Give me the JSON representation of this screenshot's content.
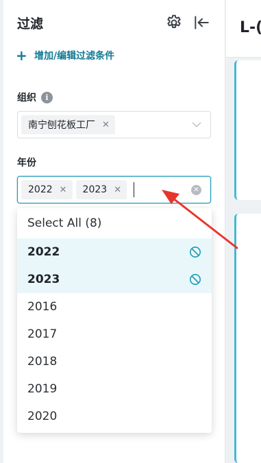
{
  "sidebar": {
    "title": "过滤",
    "add_filter_label": "增加/编辑过滤条件",
    "organization": {
      "label": "组织",
      "selected_tags": [
        "南宁刨花板工厂"
      ]
    },
    "year": {
      "label": "年份",
      "selected_tags": [
        "2022",
        "2023"
      ]
    }
  },
  "dropdown": {
    "select_all_label": "Select All (8)",
    "options": [
      {
        "label": "2022",
        "selected": true
      },
      {
        "label": "2023",
        "selected": true
      },
      {
        "label": "2016",
        "selected": false
      },
      {
        "label": "2017",
        "selected": false
      },
      {
        "label": "2018",
        "selected": false
      },
      {
        "label": "2019",
        "selected": false
      },
      {
        "label": "2020",
        "selected": false
      }
    ]
  },
  "main": {
    "header_text": "L-("
  },
  "colors": {
    "accent": "#127b95",
    "focus_border": "#1c9ab8",
    "selected_row": "#e9f7fa",
    "card_accent": "#43b8d3",
    "annotation_arrow": "#e8352b"
  }
}
